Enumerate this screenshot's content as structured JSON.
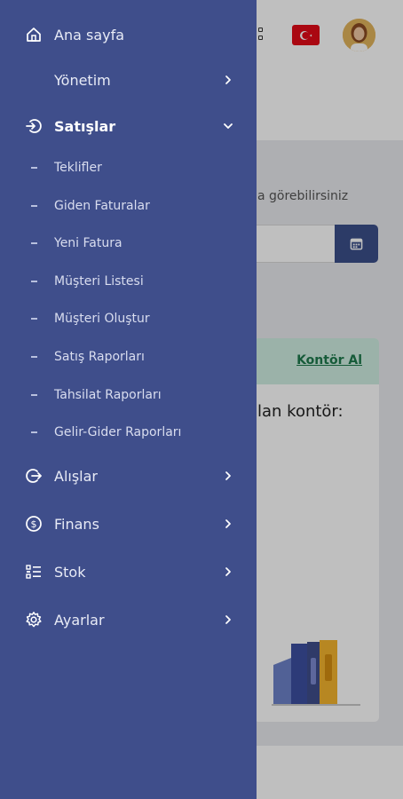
{
  "background": {
    "hint_text": "a görebilirsiniz",
    "card_link": "Kontör Al",
    "card_text": "lan kontör:"
  },
  "drawer": {
    "items": [
      {
        "label": "Ana sayfa",
        "icon": "home-icon",
        "has_chevron": false
      },
      {
        "label": "Yönetim",
        "icon": "",
        "has_chevron": true
      },
      {
        "label": "Satışlar",
        "icon": "sign-in-icon",
        "has_chevron": true,
        "expanded": true
      },
      {
        "label": "Alışlar",
        "icon": "sign-out-icon",
        "has_chevron": true
      },
      {
        "label": "Finans",
        "icon": "money-circle-icon",
        "has_chevron": true
      },
      {
        "label": "Stok",
        "icon": "list-icon",
        "has_chevron": true
      },
      {
        "label": "Ayarlar",
        "icon": "gear-icon",
        "has_chevron": true
      }
    ],
    "subitems": [
      "Teklifler",
      "Giden Faturalar",
      "Yeni Fatura",
      "Müşteri Listesi",
      "Müşteri Oluştur",
      "Satış Raporları",
      "Tahsilat Raporları",
      "Gelir-Gider Raporları"
    ]
  },
  "colors": {
    "drawer_bg": "#3f4e8b",
    "accent": "#3b4f8a",
    "flag_red": "#e30a17"
  }
}
